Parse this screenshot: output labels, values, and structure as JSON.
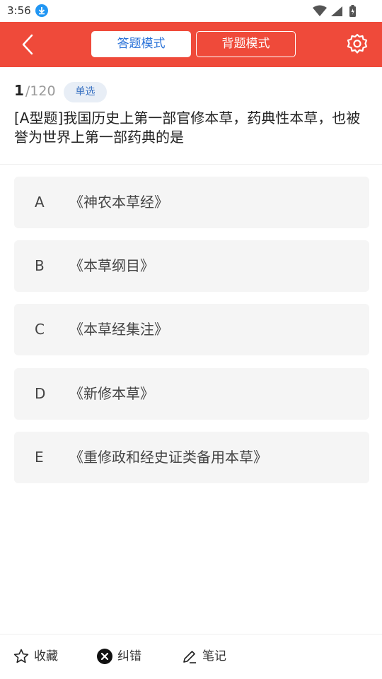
{
  "status_bar": {
    "time": "3:56"
  },
  "header": {
    "tabs": [
      {
        "label": "答题模式",
        "active": true
      },
      {
        "label": "背题模式",
        "active": false
      }
    ],
    "back_icon": "chevron-left-icon",
    "settings_icon": "gear-icon",
    "bg_color": "#ef4a3a",
    "active_tab_text_color": "#2a72d8"
  },
  "question": {
    "index": "1",
    "total": "/120",
    "type_badge": "单选",
    "text": "[A型题]我国历史上第一部官修本草，药典性本草，也被誉为世界上第一部药典的是"
  },
  "options": [
    {
      "letter": "A",
      "text": "《神农本草经》"
    },
    {
      "letter": "B",
      "text": "《本草纲目》"
    },
    {
      "letter": "C",
      "text": "《本草经集注》"
    },
    {
      "letter": "D",
      "text": "《新修本草》"
    },
    {
      "letter": "E",
      "text": "《重修政和经史证类备用本草》"
    }
  ],
  "bottom_bar": {
    "favorite": {
      "label": "收藏",
      "icon": "star-icon"
    },
    "report_error": {
      "label": "纠错",
      "icon": "close-circle-icon"
    },
    "notes": {
      "label": "笔记",
      "icon": "pencil-icon"
    }
  }
}
